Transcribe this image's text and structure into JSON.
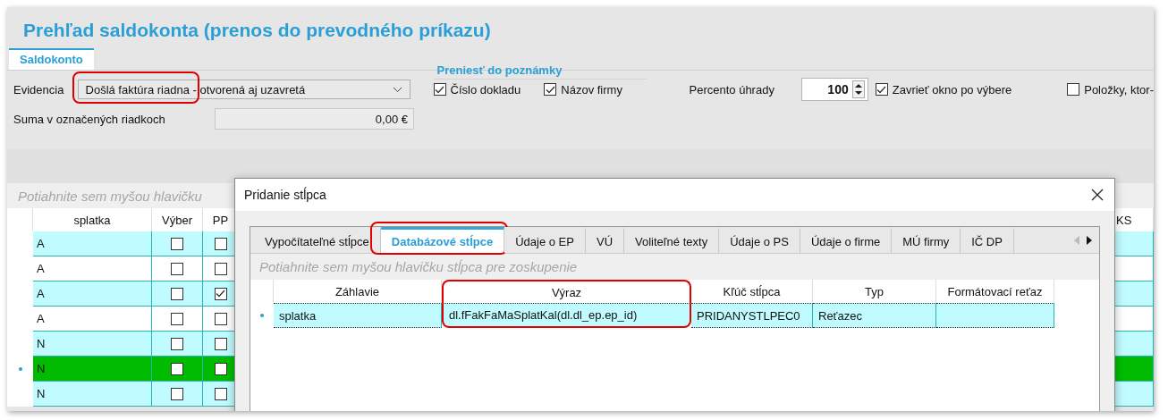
{
  "window": {
    "title": "Prehľad saldokonta (prenos do prevodného príkazu)"
  },
  "tabs": [
    {
      "label": "Saldokonto",
      "selected": true
    }
  ],
  "form": {
    "evidencia": {
      "label": "Evidencia",
      "value": "Došlá faktúra riadna - otvorená aj uzavretá",
      "highlighted": true
    },
    "suma": {
      "label": "Suma v označených riadkoch",
      "value": "0,00 €"
    },
    "transfer_group": {
      "title": "Preniesť do poznámky",
      "options": [
        {
          "label": "Číslo dokladu",
          "checked": true
        },
        {
          "label": "Názov firmy",
          "checked": true
        }
      ]
    },
    "percento": {
      "label": "Percento úhrady",
      "value": "100"
    },
    "options": [
      {
        "label": "Zavrieť okno po výbere",
        "checked": true
      },
      {
        "label": "Položky, ktor-",
        "checked": false
      }
    ]
  },
  "grid": {
    "group_hint": "Potiahnite sem myšou hlavičku",
    "columns": [
      "splatka",
      "Výber",
      "PP",
      "KS"
    ],
    "rows": [
      {
        "splatka": "A",
        "vyber": false,
        "pp": false,
        "selected": false
      },
      {
        "splatka": "A",
        "vyber": false,
        "pp": false,
        "selected": false
      },
      {
        "splatka": "A",
        "vyber": false,
        "pp": true,
        "selected": false
      },
      {
        "splatka": "A",
        "vyber": false,
        "pp": false,
        "selected": false
      },
      {
        "splatka": "N",
        "vyber": false,
        "pp": false,
        "selected": false
      },
      {
        "splatka": "N",
        "vyber": false,
        "pp": false,
        "selected": true
      },
      {
        "splatka": "N",
        "vyber": false,
        "pp": false,
        "selected": false
      }
    ]
  },
  "dialog": {
    "title": "Pridanie stĺpca",
    "tabs": [
      {
        "label": "Vypočítateľné stĺpce",
        "selected": false,
        "highlighted": false
      },
      {
        "label": "Databázové stĺpce",
        "selected": true,
        "highlighted": true
      },
      {
        "label": "Údaje o EP",
        "selected": false,
        "highlighted": false
      },
      {
        "label": "VÚ",
        "selected": false,
        "highlighted": false
      },
      {
        "label": "Voliteľné texty",
        "selected": false,
        "highlighted": false
      },
      {
        "label": "Údaje o PS",
        "selected": false,
        "highlighted": false
      },
      {
        "label": "Údaje o firme",
        "selected": false,
        "highlighted": false
      },
      {
        "label": "MÚ firmy",
        "selected": false,
        "highlighted": false
      },
      {
        "label": "IČ DP",
        "selected": false,
        "highlighted": false
      }
    ],
    "group_hint": "Potiahnite sem myšou hlavičku stĺpca pre zoskupenie",
    "columns": [
      {
        "label": "Záhlavie",
        "highlighted": false
      },
      {
        "label": "Výraz",
        "highlighted": true
      },
      {
        "label": "Kľúč stĺpca",
        "highlighted": false
      },
      {
        "label": "Typ",
        "highlighted": false
      },
      {
        "label": "Formátovací reťaz",
        "highlighted": false
      }
    ],
    "rows": [
      {
        "cells": [
          "splatka",
          "dl.fFakFaMaSplatKal(dl.dl_ep.ep_id)",
          "PRIDANYSTLPEC0",
          "Reťazec",
          ""
        ],
        "selected": true
      }
    ]
  }
}
